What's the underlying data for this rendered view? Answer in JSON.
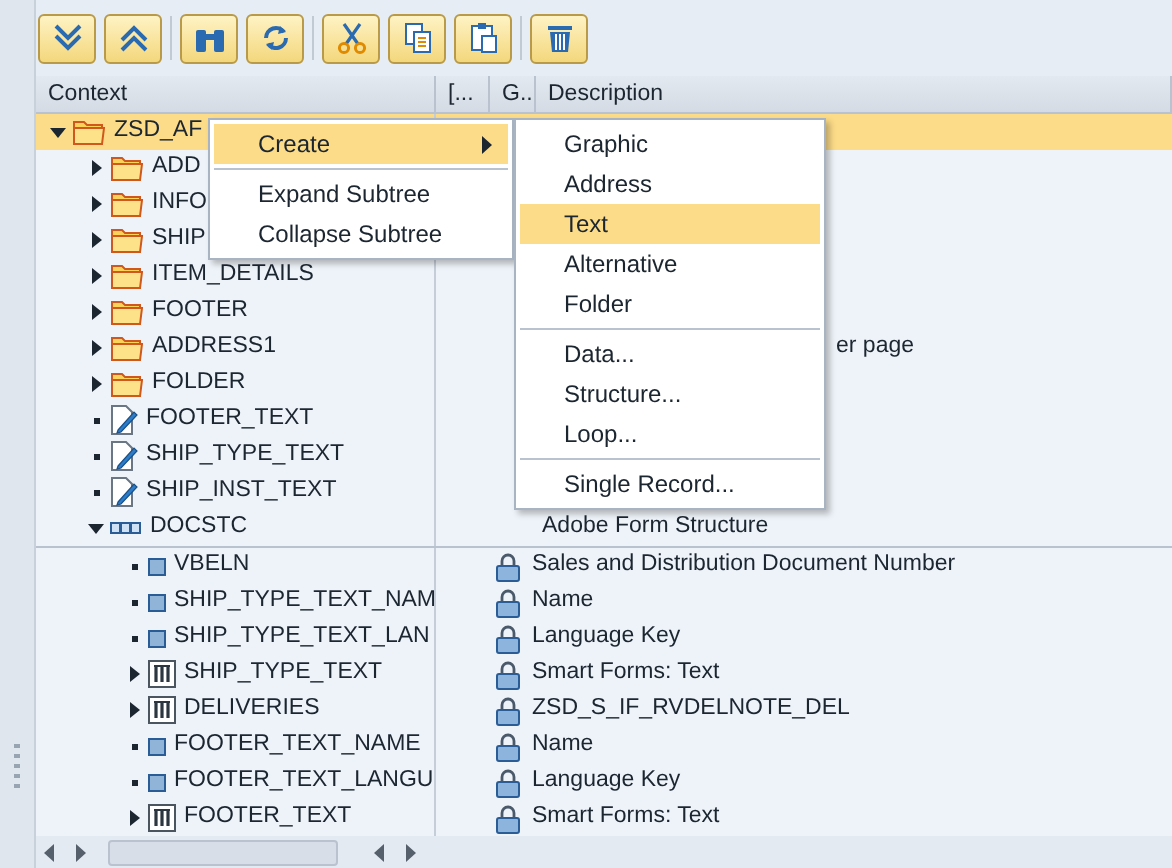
{
  "toolbar": {
    "buttons": [
      {
        "kind": "expand"
      },
      {
        "kind": "collapse"
      },
      {
        "kind": "find"
      },
      {
        "kind": "refresh"
      },
      {
        "kind": "cut"
      },
      {
        "kind": "copy"
      },
      {
        "kind": "paste"
      },
      {
        "kind": "delete"
      }
    ]
  },
  "columns": [
    "Context",
    "[...",
    "G..",
    "Description"
  ],
  "tree": [
    {
      "name": "ZSD_AF",
      "kind": "folder",
      "expanded": true,
      "selected": true,
      "children": [
        {
          "name": "ADD",
          "kind": "folder",
          "expanded": false,
          "selected": false
        },
        {
          "name": "INFO",
          "kind": "folder",
          "expanded": false,
          "selected": false
        },
        {
          "name": "SHIP",
          "kind": "folder",
          "expanded": false,
          "selected": false
        },
        {
          "name": "ITEM_DETAILS",
          "kind": "folder",
          "expanded": false,
          "selected": false
        },
        {
          "name": "FOOTER",
          "kind": "folder",
          "expanded": false,
          "selected": false
        },
        {
          "name": "ADDRESS1",
          "kind": "folder",
          "expanded": false,
          "selected": false,
          "description": "er page"
        },
        {
          "name": "FOLDER",
          "kind": "folder",
          "expanded": false,
          "selected": false
        },
        {
          "name": "FOOTER_TEXT",
          "kind": "text",
          "selected": false
        },
        {
          "name": "SHIP_TYPE_TEXT",
          "kind": "text",
          "selected": false
        },
        {
          "name": "SHIP_INST_TEXT",
          "kind": "text",
          "selected": false
        },
        {
          "name": "DOCSTC",
          "kind": "structure",
          "expanded": true,
          "selected": false,
          "description": "Adobe Form Structure",
          "children": [
            {
              "name": "VBELN",
              "kind": "field",
              "selected": false,
              "locked": true,
              "description": "Sales and Distribution Document Number"
            },
            {
              "name": "SHIP_TYPE_TEXT_NAM",
              "kind": "field",
              "selected": false,
              "locked": true,
              "description": "Name"
            },
            {
              "name": "SHIP_TYPE_TEXT_LAN",
              "kind": "field",
              "selected": false,
              "locked": true,
              "description": "Language Key"
            },
            {
              "name": "SHIP_TYPE_TEXT",
              "kind": "table",
              "expanded": false,
              "selected": false,
              "locked": true,
              "description": "Smart Forms: Text"
            },
            {
              "name": "DELIVERIES",
              "kind": "table",
              "expanded": false,
              "selected": false,
              "locked": true,
              "description": "ZSD_S_IF_RVDELNOTE_DEL"
            },
            {
              "name": "FOOTER_TEXT_NAME",
              "kind": "field",
              "selected": false,
              "locked": true,
              "description": "Name"
            },
            {
              "name": "FOOTER_TEXT_LANGU",
              "kind": "field",
              "selected": false,
              "locked": true,
              "description": "Language Key"
            },
            {
              "name": "FOOTER_TEXT",
              "kind": "table",
              "expanded": false,
              "selected": false,
              "locked": true,
              "description": "Smart Forms: Text"
            }
          ]
        }
      ]
    }
  ],
  "context_menu": {
    "items": [
      {
        "label": "Create",
        "selected": true,
        "submenu": true
      },
      {
        "label": "Expand Subtree",
        "selected": false,
        "submenu": false
      },
      {
        "label": "Collapse Subtree",
        "selected": false,
        "submenu": false
      }
    ]
  },
  "submenu": {
    "groups": [
      [
        {
          "label": "Graphic",
          "selected": false
        },
        {
          "label": "Address",
          "selected": false
        },
        {
          "label": "Text",
          "selected": true
        },
        {
          "label": "Alternative",
          "selected": false
        },
        {
          "label": "Folder",
          "selected": false
        }
      ],
      [
        {
          "label": "Data...",
          "selected": false
        },
        {
          "label": "Structure...",
          "selected": false
        },
        {
          "label": "Loop...",
          "selected": false
        }
      ],
      [
        {
          "label": "Single Record...",
          "selected": false
        }
      ]
    ]
  }
}
